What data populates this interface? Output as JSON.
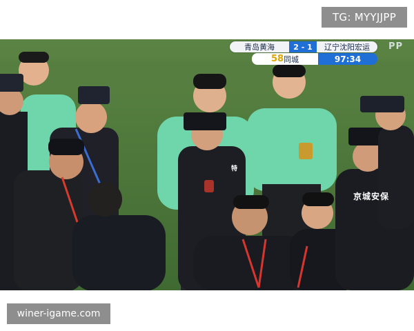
{
  "watermark": {
    "tg": "TG: MYYJJPP",
    "site": "winer-igame.com"
  },
  "scoreboard": {
    "home_team": "青岛黄海",
    "score": "2 - 1",
    "away_team": "辽宁沈阳宏运",
    "channel_number": "58",
    "channel_name": "同城",
    "clock": "97:34",
    "colors": {
      "primary": "#1f6fd6",
      "panel": "#f1f3f6"
    }
  },
  "broadcaster_mark": "PP",
  "scene": {
    "jacket_text": "京城安保",
    "sleeve_text": "特",
    "pitch_color": "#4f7a3c",
    "referee_shirt_color": "#6fd6ac",
    "police_uniform_color": "#1b1c22"
  }
}
